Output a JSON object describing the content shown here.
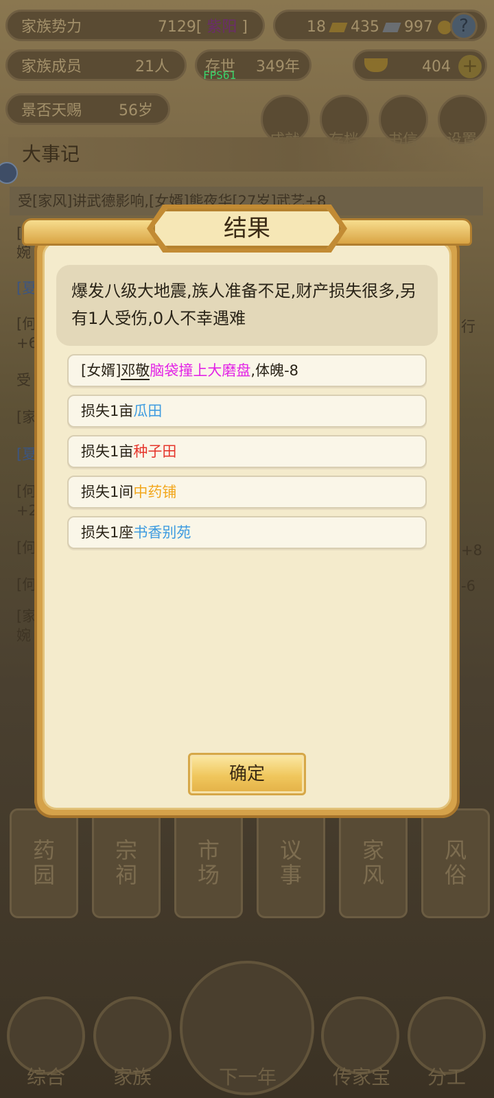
{
  "status_bar": {
    "family_power_label": "家族势力",
    "family_power_value": "7129[ ",
    "family_power_rank": "紫阳",
    "family_power_close": " ]",
    "resource_a": "18",
    "resource_b": "435",
    "resource_c": "997",
    "members_label": "家族成员",
    "members_value": "21人",
    "exist_label": "存世",
    "exist_value": "349年",
    "gold_ingot": "404",
    "blessing_label": "景否天赐",
    "blessing_value": "56岁"
  },
  "fps": "FPS61",
  "top_buttons": [
    "成就",
    "存档",
    "书信",
    "设置"
  ],
  "events_title": "大事记",
  "events_first_row": "受[家风]讲武德影响,[女婿]熊夜华[27岁]武艺+8",
  "events_left_fragments": [
    "[",
    "婉",
    "[夏",
    "[何",
    "+6",
    "受",
    "[家",
    "[夏",
    "[何",
    "+2",
    "[何",
    "[何",
    "[家",
    "婉"
  ],
  "events_right_fragments": [
    "行",
    "+8",
    "-6"
  ],
  "bottom_nav": [
    {
      "line1": "药",
      "line2": "园"
    },
    {
      "line1": "宗",
      "line2": "祠"
    },
    {
      "line1": "市",
      "line2": "场"
    },
    {
      "line1": "议",
      "line2": "事"
    },
    {
      "line1": "家",
      "line2": "风"
    },
    {
      "line1": "风",
      "line2": "俗"
    }
  ],
  "main_nav": [
    "综合",
    "家族",
    "下一年",
    "传家宝",
    "分工"
  ],
  "dialog": {
    "title": "结果",
    "summary": "爆发八级大地震,族人准备不足,财产损失很多,另有1人受伤,0人不幸遇难",
    "items": [
      {
        "prefix": "[女婿]",
        "name": "邓敬",
        "highlight": "脑袋撞上大磨盘",
        "suffix": ",体魄-8",
        "color": "#e223e6"
      },
      {
        "prefix": "损失1亩",
        "name": "",
        "highlight": "瓜田",
        "suffix": "",
        "color": "#3d9be0"
      },
      {
        "prefix": "损失1亩",
        "name": "",
        "highlight": "种子田",
        "suffix": "",
        "color": "#e5352b"
      },
      {
        "prefix": "损失1间",
        "name": "",
        "highlight": "中药铺",
        "suffix": "",
        "color": "#f2a71c"
      },
      {
        "prefix": "损失1座",
        "name": "",
        "highlight": "书香别苑",
        "suffix": "",
        "color": "#3d9be0"
      }
    ],
    "confirm_label": "确定"
  },
  "colors": {
    "dialog_bg": "#f4ebcc",
    "frame_gold": "#d5a24a",
    "button_gold": "#f0c75d"
  }
}
